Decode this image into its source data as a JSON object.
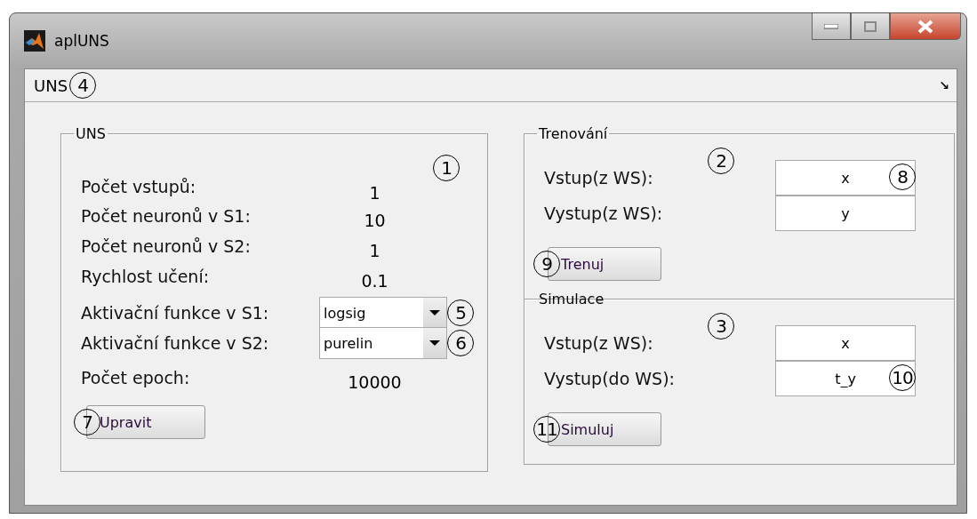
{
  "window": {
    "title": "aplUNS"
  },
  "menu": {
    "label": "UNS",
    "callout": "4",
    "corner": "↘"
  },
  "uns": {
    "title": "UNS",
    "callout": "1",
    "rows": [
      {
        "kind": "value",
        "label": "Počet vstupů:",
        "value": "1"
      },
      {
        "kind": "value",
        "label": "Počet neuronů v S1:",
        "value": "10"
      },
      {
        "kind": "value",
        "label": "Počet neuronů v S2:",
        "value": "1"
      },
      {
        "kind": "value",
        "label": "Rychlost učení:",
        "value": "0.1"
      },
      {
        "kind": "select",
        "label": "Aktivační funkce v S1:",
        "value": "logsig",
        "callout": "5"
      },
      {
        "kind": "select",
        "label": "Aktivační funkce v S2:",
        "value": "purelin",
        "callout": "6"
      },
      {
        "kind": "value",
        "label": "Počet epoch:",
        "value": "10000"
      }
    ],
    "button": {
      "label": "Upravit",
      "callout": "7"
    }
  },
  "training": {
    "title": "Trenování",
    "callout": "2",
    "fields": [
      {
        "label": "Vstup(z WS):",
        "value": "x",
        "callout": "8"
      },
      {
        "label": "Vystup(z WS):",
        "value": "y"
      }
    ],
    "button": {
      "label": "Trenuj",
      "callout": "9"
    }
  },
  "simulation": {
    "title": "Simulace",
    "callout": "3",
    "fields": [
      {
        "label": "Vstup(z WS):",
        "value": "x"
      },
      {
        "label": "Vystup(do WS):",
        "value": "t_y",
        "callout": "10"
      }
    ],
    "button": {
      "label": "Simuluj",
      "callout": "11"
    }
  }
}
